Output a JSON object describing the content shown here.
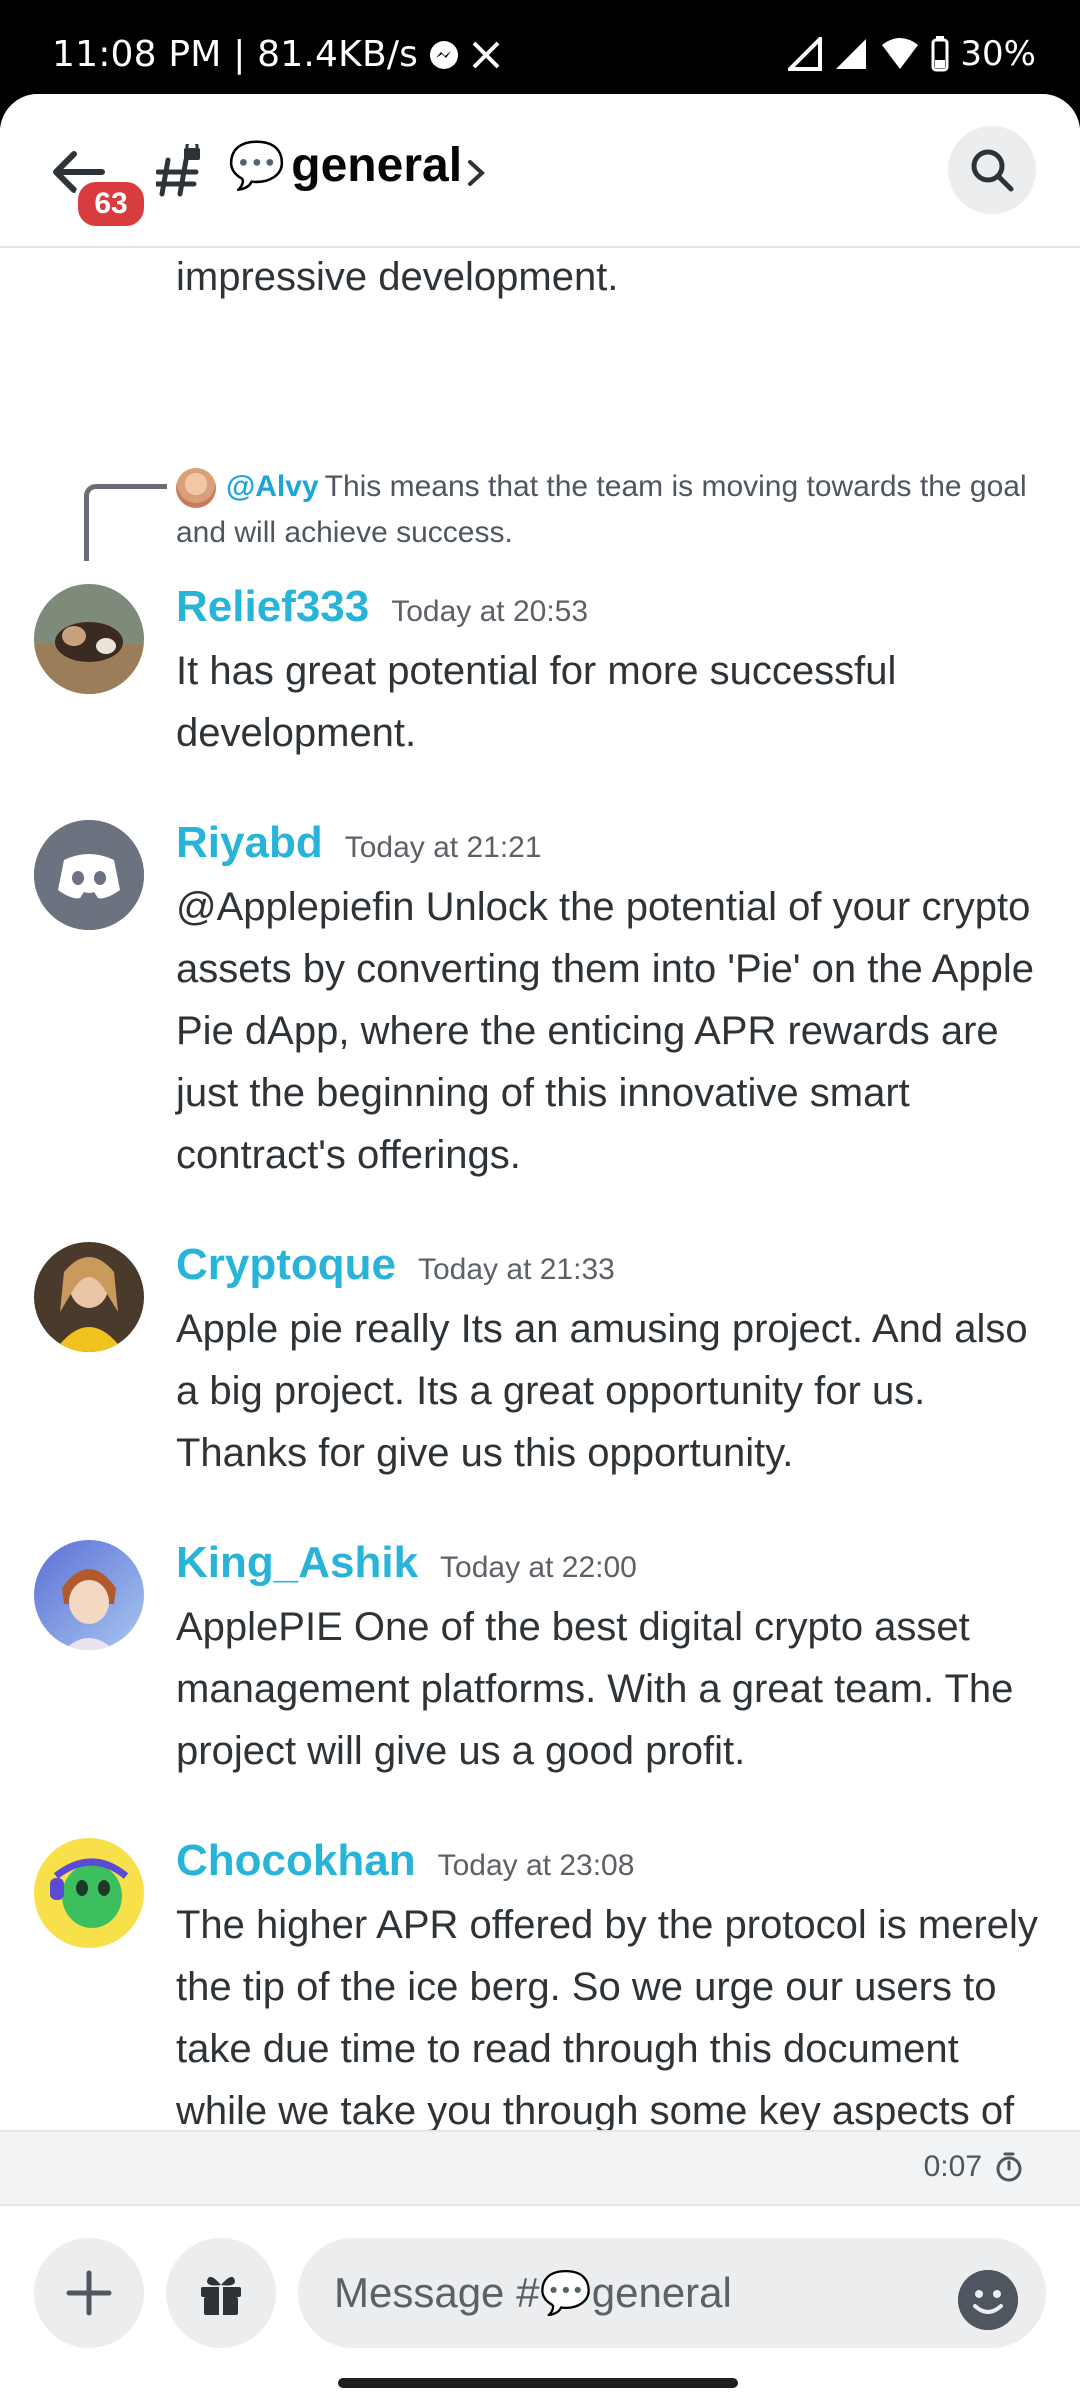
{
  "status_bar": {
    "time_and_speed": "11:08 PM | 81.4KB/s",
    "battery": "30%"
  },
  "header": {
    "badge_count": "63",
    "channel_emoji": "💬",
    "channel_name": "general"
  },
  "top_partial_text": "impressive development.",
  "reply": {
    "mention": "@Alvy",
    "text": "This means that the team is moving towards the goal and will achieve success."
  },
  "messages": [
    {
      "author": "Relief333",
      "timestamp": "Today at 20:53",
      "text": "It has great potential for more successful development."
    },
    {
      "author": "Riyabd",
      "timestamp": "Today at 21:21",
      "text": "@Applepiefin Unlock the potential of your crypto assets by converting them into 'Pie' on the Apple Pie dApp, where the enticing APR rewards are just the beginning of this innovative smart contract's offerings."
    },
    {
      "author": "Cryptoque",
      "timestamp": "Today at 21:33",
      "text": "Apple pie really Its an amusing project. And also a big project. Its a great opportunity for us.  Thanks for give us this opportunity."
    },
    {
      "author": "King_Ashik",
      "timestamp": "Today at 22:00",
      "text": "ApplePIE One of the best digital crypto asset management platforms. With a great team. The project will give us a good profit."
    },
    {
      "author": "Chocokhan",
      "timestamp": "Today at 23:08",
      "text": "The higher APR offered by the protocol is merely the tip of the ice berg. So we urge our users to take due time to read through this document while we take you through some key aspects of it!"
    }
  ],
  "slowmode": {
    "time": "0:07"
  },
  "composer": {
    "placeholder": "Message #💬general"
  },
  "colors": {
    "username": "#27b4d8",
    "badge": "#d83c3e",
    "discord_blurple_gray": "#6b7280"
  }
}
